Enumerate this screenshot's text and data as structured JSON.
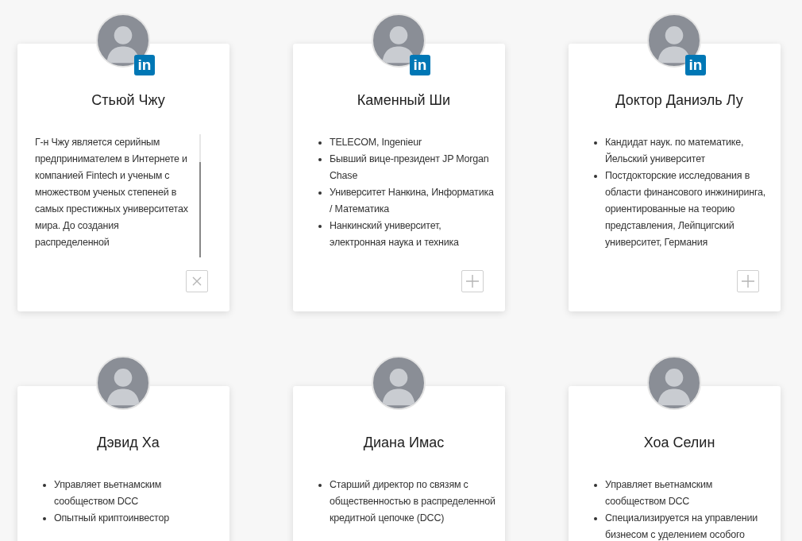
{
  "people": [
    {
      "name": "Стьюй Чжу",
      "badge": "in",
      "kind": "paragraph",
      "expanded": true,
      "text": "Г-н Чжу является серийным предпринимателем в Интернете и компанией Fintech и ученым с множеством ученых степеней в самых престижных университетах мира. До создания распределенной"
    },
    {
      "name": "Каменный Ши",
      "badge": "in",
      "kind": "list",
      "expanded": false,
      "items": [
        "TELECOM, Ingenieur",
        "Бывший вице-президент JP Morgan Chase",
        "Университет Нанкина, Информатика / Математика",
        "Нанкинский университет, электронная наука и техника"
      ]
    },
    {
      "name": "Доктор Даниэль Лу",
      "badge": "in",
      "kind": "list",
      "expanded": false,
      "items": [
        "Кандидат наук. по математике, Йельский университет",
        "Постдокторские исследования в области финансового инжиниринга, ориентированные на теорию представления, Лейпцигский университет, Германия"
      ]
    },
    {
      "name": "Дэвид Ха",
      "kind": "list",
      "items": [
        "Управляет вьетнамским сообществом DCC",
        "Опытный криптоинвестор"
      ]
    },
    {
      "name": "Диана Имас",
      "kind": "list",
      "items": [
        "Старший директор по связям с общественностью в распределенной кредитной цепочке (DCC)"
      ]
    },
    {
      "name": "Хоа Селин",
      "kind": "list",
      "items": [
        "Управляет вьетнамским сообществом DCC",
        "Специализируется на управлении бизнесом с уделением особого"
      ]
    }
  ]
}
